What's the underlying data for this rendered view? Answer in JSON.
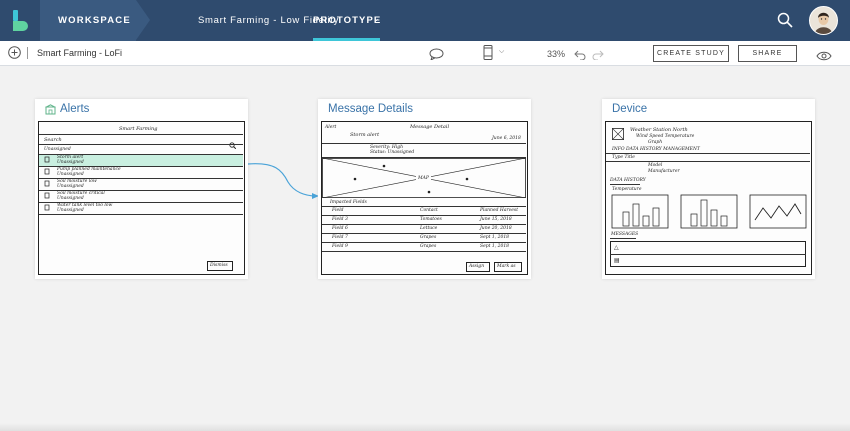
{
  "topbar": {
    "workspace_label": "WORKSPACE",
    "project_title": "Smart Farming - Low Fidelity",
    "prototype_tab": "PROTOTYPE"
  },
  "subbar": {
    "breadcrumb": "Smart Farming - LoFi",
    "zoom": "33%",
    "create_study": "CREATE STUDY",
    "share": "SHARE"
  },
  "screens": [
    {
      "title": "Alerts",
      "header": "Smart Farming",
      "search_label": "Search",
      "section_label": "Unassigned",
      "rows": [
        {
          "title": "Storm alert",
          "sub": "Unassigned"
        },
        {
          "title": "Pump planned maintenance",
          "sub": "Unassigned"
        },
        {
          "title": "Soil moisture low",
          "sub": "Unassigned"
        },
        {
          "title": "Soil moisture critical",
          "sub": "Unassigned"
        },
        {
          "title": "Water tank level too low",
          "sub": "Unassigned"
        }
      ],
      "dismiss": "Dismiss"
    },
    {
      "title": "Message Details",
      "back": "Alert",
      "header": "Message Detail",
      "date": "June 6, 2018",
      "alert_title": "Storm alert",
      "severity": "Severity: High",
      "status": "Status: Unassigned",
      "map_label": "MAP",
      "impacted_label": "Impacted Fields",
      "columns": [
        "Field",
        "Contact",
        "Planned Harvest"
      ],
      "table_rows": [
        [
          "Field 3",
          "Tomatoes",
          "June 15, 2018"
        ],
        [
          "Field 6",
          "Lettuce",
          "June 20, 2018"
        ],
        [
          "Field 7",
          "Grapes",
          "Sept 1, 2018"
        ],
        [
          "Field 9",
          "Grapes",
          "Sept 1, 2018"
        ]
      ],
      "assign": "Assign",
      "mark_as": "Mark as"
    },
    {
      "title": "Device",
      "device_name": "Weather Station North",
      "device_detail1": "Wind Speed  Temperature",
      "device_detail2": "Graph",
      "tabs": "INFO  DATA  HISTORY  MANAGEMENT",
      "type_label": "Type  Title",
      "model": "Model",
      "manufacturer": "Manufacturer",
      "data_history": "DATA HISTORY",
      "series_label": "Temperature",
      "messages": "MESSAGES"
    }
  ],
  "colors": {
    "navbar": "#2f4b6e",
    "accent": "#3ec6d8",
    "link_title": "#3a73a8",
    "row_highlight": "#c9efe0",
    "connector": "#4aa3d8"
  }
}
